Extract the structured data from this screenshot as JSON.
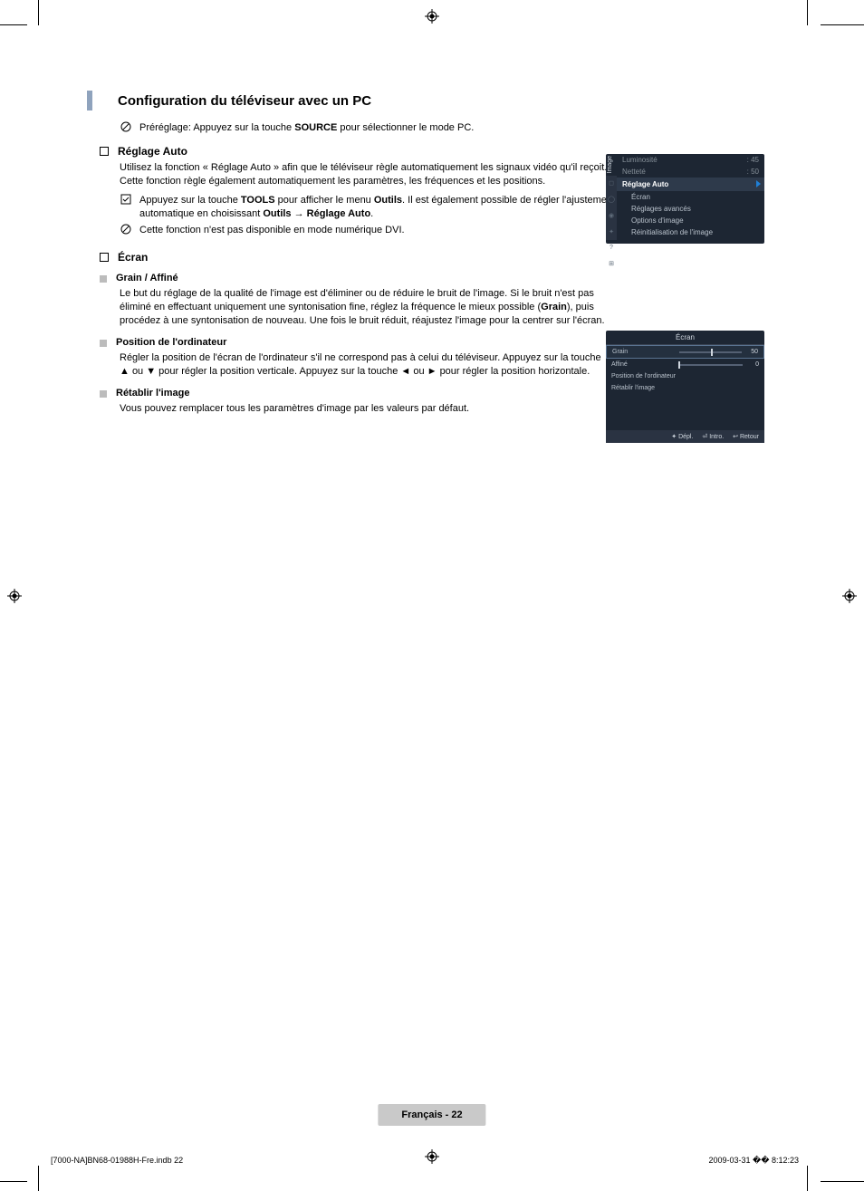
{
  "section_title": "Configuration du téléviseur avec un PC",
  "preset_line_prefix": "Préréglage: Appuyez sur la touche ",
  "preset_line_bold": "SOURCE",
  "preset_line_suffix": " pour sélectionner le mode PC.",
  "reglage_auto": {
    "heading": "Réglage Auto",
    "body": "Utilisez la fonction « Réglage Auto » afin que le téléviseur règle automatiquement les signaux vidéo qu'il reçoit. Cette fonction règle également automatiquement les paramètres, les fréquences et les positions.",
    "tool_prefix": "Appuyez sur la touche ",
    "tool_bold1": "TOOLS",
    "tool_mid": " pour afficher le menu ",
    "tool_bold2": "Outils",
    "tool_after": ". Il est également possible de régler l'ajustement automatique en choisissant ",
    "tool_bold3": "Outils",
    "tool_arrow": " → ",
    "tool_bold4": "Réglage Auto",
    "tool_end": ".",
    "note2": "Cette fonction n'est pas disponible en mode numérique DVI."
  },
  "ecran": {
    "heading": "Écran",
    "grain_heading": "Grain / Affiné",
    "grain_body_prefix": "Le but du réglage de la qualité de l'image est d'éliminer ou de réduire le bruit de l'image. Si le bruit n'est pas éliminé en effectuant uniquement une syntonisation fine, réglez la fréquence le mieux possible (",
    "grain_bold": "Grain",
    "grain_body_suffix": "), puis procédez à une syntonisation de nouveau. Une fois le bruit réduit, réajustez l'image pour la centrer sur l'écran.",
    "position_heading": "Position de l'ordinateur",
    "position_body": "Régler la position de l'écran de l'ordinateur s'il ne correspond pas à celui du téléviseur. Appuyez sur la touche ▲ ou ▼ pour régler la position verticale. Appuyez sur la touche ◄ ou ► pour régler la position horizontale.",
    "retablir_heading": "Rétablir l'image",
    "retablir_body": "Vous pouvez remplacer tous les paramètres d'image par les valeurs par défaut."
  },
  "osd1": {
    "side_label": "Image",
    "rows": {
      "luminosite": {
        "label": "Luminosité",
        "value": ": 45"
      },
      "nettete": {
        "label": "Netteté",
        "value": ": 50"
      }
    },
    "selected": "Réglage Auto",
    "items": [
      "Écran",
      "Réglages avancés",
      "Options d'image",
      "Réinitialisation de l'image"
    ]
  },
  "osd2": {
    "title": "Écran",
    "rows": [
      {
        "label": "Grain",
        "value": "50",
        "pos": 50,
        "selected": true
      },
      {
        "label": "Affiné",
        "value": "0",
        "pos": 0,
        "selected": false
      }
    ],
    "items": [
      "Position de l'ordinateur",
      "Rétablir l'image"
    ],
    "footer": {
      "move": "Dépl.",
      "enter": "Intro.",
      "return": "Retour"
    }
  },
  "page_footer": "Français - 22",
  "doc_footer": {
    "left": "[7000-NA]BN68-01988H-Fre.indb   22",
    "right": "2009-03-31   �� 8:12:23"
  }
}
